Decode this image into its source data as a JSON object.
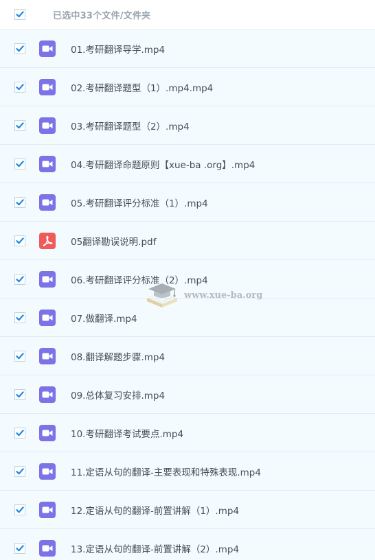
{
  "header": {
    "selected_label": "已选中33个文件/文件夹",
    "checked": true
  },
  "colors": {
    "check_mark": "#1e88e5",
    "checkbox_border": "#b7d5e9",
    "row_background": "#f4fbfe",
    "video_icon": "#7c73e6",
    "pdf_icon": "#f05a5a"
  },
  "files": [
    {
      "name": "01.考研翻译导学.mp4",
      "icon": "video-icon",
      "checked": true
    },
    {
      "name": "02.考研翻译题型（1）.mp4.mp4",
      "icon": "video-icon",
      "checked": true
    },
    {
      "name": "03.考研翻译题型（2）.mp4",
      "icon": "video-icon",
      "checked": true
    },
    {
      "name": "04.考研翻译命题原则【xue-ba .org】.mp4",
      "icon": "video-icon",
      "checked": true
    },
    {
      "name": "05.考研翻译评分标准（1）.mp4",
      "icon": "video-icon",
      "checked": true
    },
    {
      "name": "05翻译勘误说明.pdf",
      "icon": "pdf-icon",
      "checked": true
    },
    {
      "name": "06.考研翻译评分标准（2）.mp4",
      "icon": "video-icon",
      "checked": true
    },
    {
      "name": "07.做翻译.mp4",
      "icon": "video-icon",
      "checked": true
    },
    {
      "name": "08.翻译解题步骤.mp4",
      "icon": "video-icon",
      "checked": true
    },
    {
      "name": "09.总体复习安排.mp4",
      "icon": "video-icon",
      "checked": true
    },
    {
      "name": "10.考研翻译考试要点.mp4",
      "icon": "video-icon",
      "checked": true
    },
    {
      "name": "11.定语从句的翻译-主要表现和特殊表现.mp4",
      "icon": "video-icon",
      "checked": true
    },
    {
      "name": "12.定语从句的翻译-前置讲解（1）.mp4",
      "icon": "video-icon",
      "checked": true
    },
    {
      "name": "13.定语从句的翻译-前置讲解（2）.mp4",
      "icon": "video-icon",
      "checked": true
    }
  ],
  "watermark": {
    "text": "www.xue-ba.org",
    "icon": "graduation-cap-book-icon"
  }
}
